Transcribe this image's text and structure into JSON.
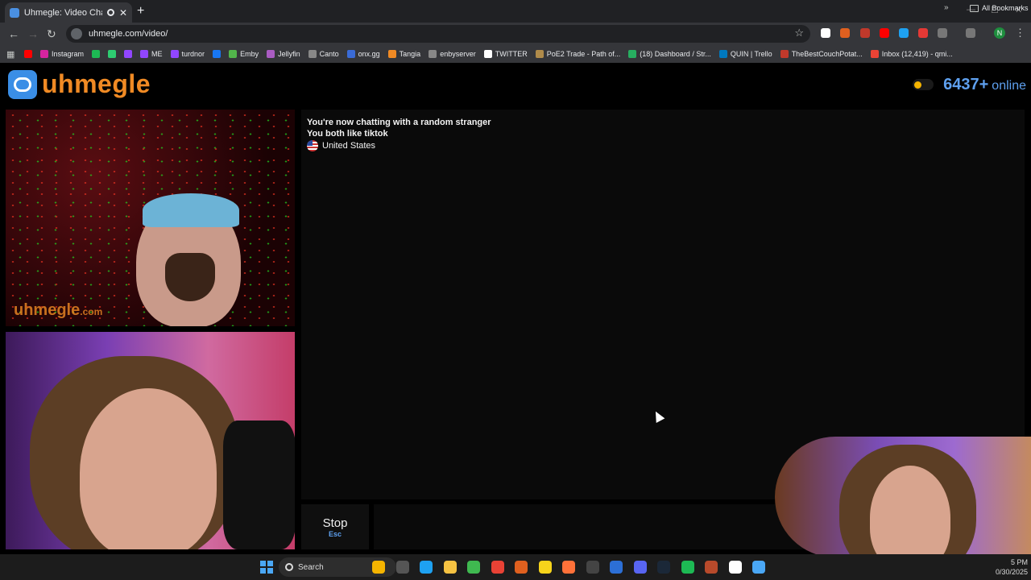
{
  "browser": {
    "tab_title": "Uhmegle: Video Chat | Rand",
    "tab_close": "✕",
    "new_tab": "+",
    "url": "uhmegle.com/video/",
    "bookmarks": [
      {
        "label": "",
        "color": "#ff0000"
      },
      {
        "label": "Instagram",
        "color": "#d6249f"
      },
      {
        "label": "",
        "color": "#1db954"
      },
      {
        "label": "",
        "color": "#2ecc71"
      },
      {
        "label": "",
        "color": "#9146ff"
      },
      {
        "label": "ME",
        "color": "#9146ff"
      },
      {
        "label": "turdnor",
        "color": "#9146ff"
      },
      {
        "label": "",
        "color": "#1877f2"
      },
      {
        "label": "Emby",
        "color": "#52b54b"
      },
      {
        "label": "Jellyfin",
        "color": "#aa5cc3"
      },
      {
        "label": "Canto",
        "color": "#888888"
      },
      {
        "label": "onx.gg",
        "color": "#3a6bd6"
      },
      {
        "label": "Tangia",
        "color": "#f08a24"
      },
      {
        "label": "enbyserver",
        "color": "#888888"
      },
      {
        "label": "TWITTER",
        "color": "#ffffff"
      },
      {
        "label": "PoE2 Trade - Path of...",
        "color": "#b08b4a"
      },
      {
        "label": "(18) Dashboard / Str...",
        "color": "#27ae60"
      },
      {
        "label": "QUIN | Trello",
        "color": "#0079bf"
      },
      {
        "label": "TheBestCouchPotat...",
        "color": "#c0392b"
      },
      {
        "label": "Inbox (12,419) - qmi...",
        "color": "#ea4335"
      }
    ],
    "bookmarks_more": "»",
    "all_bookmarks": "All Bookmarks",
    "profile_initial": "N"
  },
  "site": {
    "logo_text": "uhmegle",
    "online_count": "6437+",
    "online_label": "online",
    "watermark": "uhmegle",
    "watermark_suffix": ".com"
  },
  "chat": {
    "line1": "You're now chatting with a random stranger",
    "line2": "You both like tiktok",
    "country": "United States"
  },
  "controls": {
    "stop_label": "Stop",
    "stop_key": "Esc"
  },
  "taskbar": {
    "search_label": "Search",
    "clock_time": "5 PM",
    "clock_date": "0/30/2025",
    "apps": [
      {
        "name": "widgets-icon",
        "color": "#f5b400"
      },
      {
        "name": "browser-icon",
        "color": "#555555"
      },
      {
        "name": "edge-icon",
        "color": "#1ea1f1"
      },
      {
        "name": "file-explorer-icon",
        "color": "#f5c242"
      },
      {
        "name": "terminal-icon",
        "color": "#3fb950"
      },
      {
        "name": "chrome-icon",
        "color": "#e94235"
      },
      {
        "name": "basketball-icon",
        "color": "#e0601f"
      },
      {
        "name": "sticky-notes-icon",
        "color": "#f7d41b"
      },
      {
        "name": "firefox-icon",
        "color": "#ff7139"
      },
      {
        "name": "app-icon",
        "color": "#444444"
      },
      {
        "name": "chat-app-icon",
        "color": "#2c6fd6"
      },
      {
        "name": "discord-icon",
        "color": "#5865f2"
      },
      {
        "name": "steam-icon",
        "color": "#1b2838"
      },
      {
        "name": "spotify-icon",
        "color": "#1db954"
      },
      {
        "name": "game-icon",
        "color": "#b84a2b"
      },
      {
        "name": "capcut-icon",
        "color": "#ffffff"
      },
      {
        "name": "notepad-icon",
        "color": "#4aa7f5"
      }
    ]
  }
}
